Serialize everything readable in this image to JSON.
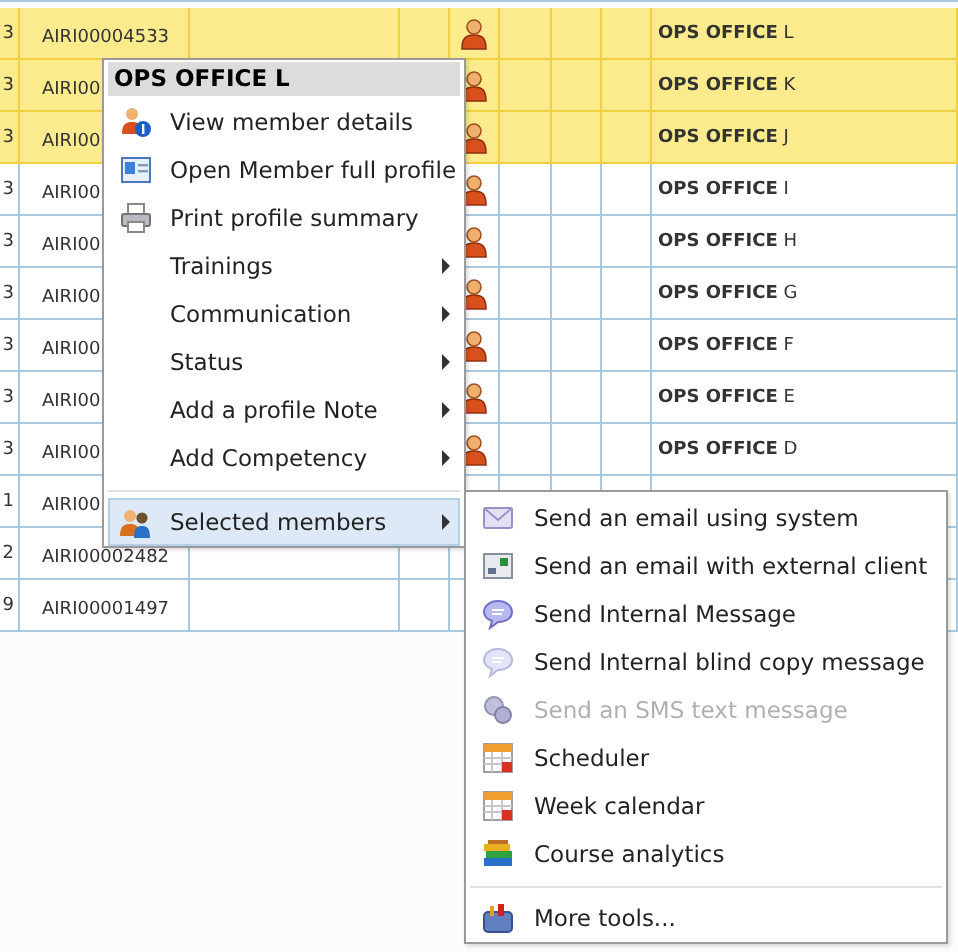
{
  "table": {
    "rows": [
      {
        "column_1": "3",
        "member_id": "AIRI00004533",
        "person_icon": true,
        "name": "**OPS OFFICE** L",
        "selected": true
      },
      {
        "column_1": "3",
        "member_id": "AIRI00",
        "person_icon": true,
        "name": "**OPS OFFICE** K",
        "selected": true
      },
      {
        "column_1": "3",
        "member_id": "AIRI00",
        "person_icon": true,
        "name": "**OPS OFFICE** J",
        "selected": true
      },
      {
        "column_1": "3",
        "member_id": "AIRI00",
        "person_icon": true,
        "name": "**OPS OFFICE** I",
        "selected": false
      },
      {
        "column_1": "3",
        "member_id": "AIRI00",
        "person_icon": true,
        "name": "**OPS OFFICE** H",
        "selected": false
      },
      {
        "column_1": "3",
        "member_id": "AIRI00",
        "person_icon": true,
        "name": "**OPS OFFICE** G",
        "selected": false
      },
      {
        "column_1": "3",
        "member_id": "AIRI00",
        "person_icon": true,
        "name": "**OPS OFFICE** F",
        "selected": false
      },
      {
        "column_1": "3",
        "member_id": "AIRI00",
        "person_icon": true,
        "name": "**OPS OFFICE** E",
        "selected": false
      },
      {
        "column_1": "3",
        "member_id": "AIRI00",
        "person_icon": true,
        "name": "**OPS OFFICE** D",
        "selected": false
      },
      {
        "column_1": "1",
        "member_id": "AIRI00",
        "person_icon": false,
        "selected": false
      },
      {
        "column_1": "2",
        "member_id": "AIRI00002482",
        "person_icon": false,
        "selected": false
      },
      {
        "column_1": "9",
        "member_id": "AIRI00001497",
        "person_icon": false,
        "selected": false
      }
    ]
  },
  "context_menu": {
    "title": "OPS OFFICE L",
    "items": [
      {
        "kind": "action",
        "label": "View member details",
        "selected": false
      },
      {
        "kind": "action",
        "label": "Open Member full profile",
        "selected": false
      },
      {
        "kind": "action",
        "label": "Print profile summary",
        "selected": false
      },
      {
        "kind": "submenu",
        "label": "Trainings",
        "selected": false
      },
      {
        "kind": "submenu",
        "label": "Communication",
        "selected": false
      },
      {
        "kind": "submenu",
        "label": "Status",
        "selected": false
      },
      {
        "kind": "submenu",
        "label": "Add a profile Note",
        "selected": false
      },
      {
        "kind": "submenu",
        "label": "Add Competency",
        "selected": false
      },
      {
        "kind": "separator"
      },
      {
        "kind": "submenu",
        "label": "Selected members",
        "selected": true
      }
    ]
  },
  "submenu": {
    "items": [
      {
        "kind": "action",
        "label": "Send an email using system",
        "disabled": false
      },
      {
        "kind": "action",
        "label": "Send an email with external client",
        "disabled": false
      },
      {
        "kind": "action",
        "label": "Send Internal Message",
        "disabled": false
      },
      {
        "kind": "action",
        "label": "Send Internal blind copy message",
        "disabled": false
      },
      {
        "kind": "action",
        "label": "Send an SMS text message",
        "disabled": true
      },
      {
        "kind": "action",
        "label": "Scheduler",
        "disabled": false
      },
      {
        "kind": "action",
        "label": "Week calendar",
        "disabled": false
      },
      {
        "kind": "action",
        "label": "Course analytics",
        "disabled": false
      },
      {
        "kind": "separator"
      },
      {
        "kind": "action",
        "label": "More tools...",
        "disabled": false
      }
    ]
  }
}
